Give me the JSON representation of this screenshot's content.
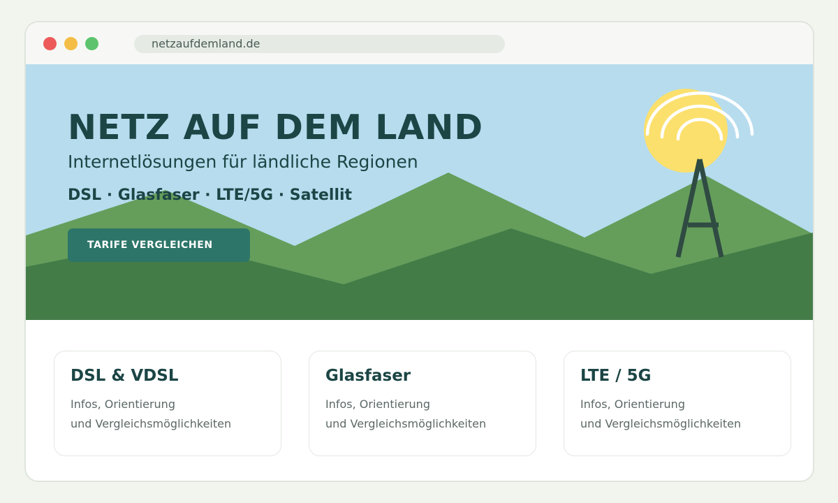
{
  "browser": {
    "url": "netzaufdemland.de",
    "controls": [
      "close",
      "minimize",
      "maximize"
    ]
  },
  "hero": {
    "title": "NETZ AUF DEM LAND",
    "subtitle": "Internetlösungen für ländliche Regionen",
    "tags": "DSL · Glasfaser · LTE/5G · Satellit",
    "cta_label": "TARIFE VERGLEICHEN"
  },
  "cards": [
    {
      "title": "DSL & VDSL",
      "line1": "Infos, Orientierung",
      "line2": "und Vergleichsmöglichkeiten"
    },
    {
      "title": "Glasfaser",
      "line1": "Infos, Orientierung",
      "line2": "und Vergleichsmöglichkeiten"
    },
    {
      "title": "LTE / 5G",
      "line1": "Infos, Orientierung",
      "line2": "und Vergleichsmöglichkeiten"
    }
  ],
  "icons": {
    "sun": "sun-icon",
    "tower": "radio-tower-icon",
    "signal": "signal-waves-icon"
  },
  "colors": {
    "dot_red": "#ec5a5a",
    "dot_yellow": "#f4bd45",
    "dot_green": "#5dc46d",
    "sky": "#b6dcee",
    "hill_light": "#659e5b",
    "hill_dark": "#447c48",
    "sun": "#fbe06d",
    "tower": "#2f4b42",
    "primary_dark": "#1c4545",
    "accent": "#2d7568",
    "text_muted": "#5c6866"
  }
}
